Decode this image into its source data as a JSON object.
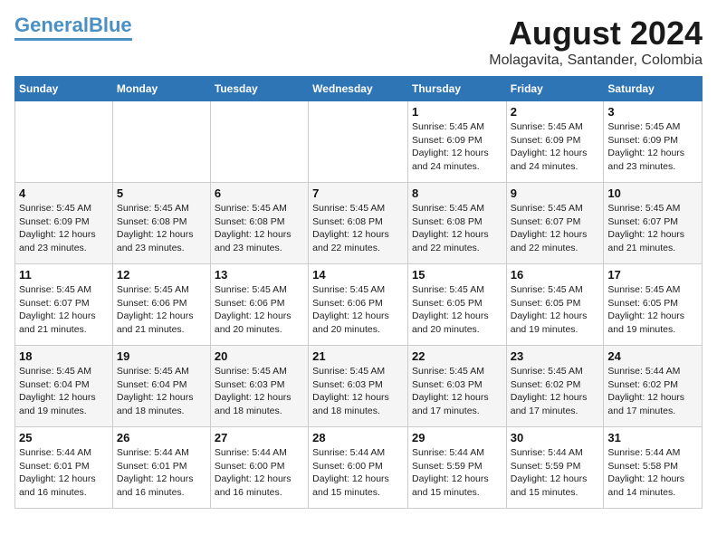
{
  "header": {
    "logo_line1": "General",
    "logo_line2": "Blue",
    "title": "August 2024",
    "subtitle": "Molagavita, Santander, Colombia"
  },
  "days_of_week": [
    "Sunday",
    "Monday",
    "Tuesday",
    "Wednesday",
    "Thursday",
    "Friday",
    "Saturday"
  ],
  "weeks": [
    [
      {
        "day": "",
        "info": ""
      },
      {
        "day": "",
        "info": ""
      },
      {
        "day": "",
        "info": ""
      },
      {
        "day": "",
        "info": ""
      },
      {
        "day": "1",
        "info": "Sunrise: 5:45 AM\nSunset: 6:09 PM\nDaylight: 12 hours and 24 minutes."
      },
      {
        "day": "2",
        "info": "Sunrise: 5:45 AM\nSunset: 6:09 PM\nDaylight: 12 hours and 24 minutes."
      },
      {
        "day": "3",
        "info": "Sunrise: 5:45 AM\nSunset: 6:09 PM\nDaylight: 12 hours and 23 minutes."
      }
    ],
    [
      {
        "day": "4",
        "info": "Sunrise: 5:45 AM\nSunset: 6:09 PM\nDaylight: 12 hours and 23 minutes."
      },
      {
        "day": "5",
        "info": "Sunrise: 5:45 AM\nSunset: 6:08 PM\nDaylight: 12 hours and 23 minutes."
      },
      {
        "day": "6",
        "info": "Sunrise: 5:45 AM\nSunset: 6:08 PM\nDaylight: 12 hours and 23 minutes."
      },
      {
        "day": "7",
        "info": "Sunrise: 5:45 AM\nSunset: 6:08 PM\nDaylight: 12 hours and 22 minutes."
      },
      {
        "day": "8",
        "info": "Sunrise: 5:45 AM\nSunset: 6:08 PM\nDaylight: 12 hours and 22 minutes."
      },
      {
        "day": "9",
        "info": "Sunrise: 5:45 AM\nSunset: 6:07 PM\nDaylight: 12 hours and 22 minutes."
      },
      {
        "day": "10",
        "info": "Sunrise: 5:45 AM\nSunset: 6:07 PM\nDaylight: 12 hours and 21 minutes."
      }
    ],
    [
      {
        "day": "11",
        "info": "Sunrise: 5:45 AM\nSunset: 6:07 PM\nDaylight: 12 hours and 21 minutes."
      },
      {
        "day": "12",
        "info": "Sunrise: 5:45 AM\nSunset: 6:06 PM\nDaylight: 12 hours and 21 minutes."
      },
      {
        "day": "13",
        "info": "Sunrise: 5:45 AM\nSunset: 6:06 PM\nDaylight: 12 hours and 20 minutes."
      },
      {
        "day": "14",
        "info": "Sunrise: 5:45 AM\nSunset: 6:06 PM\nDaylight: 12 hours and 20 minutes."
      },
      {
        "day": "15",
        "info": "Sunrise: 5:45 AM\nSunset: 6:05 PM\nDaylight: 12 hours and 20 minutes."
      },
      {
        "day": "16",
        "info": "Sunrise: 5:45 AM\nSunset: 6:05 PM\nDaylight: 12 hours and 19 minutes."
      },
      {
        "day": "17",
        "info": "Sunrise: 5:45 AM\nSunset: 6:05 PM\nDaylight: 12 hours and 19 minutes."
      }
    ],
    [
      {
        "day": "18",
        "info": "Sunrise: 5:45 AM\nSunset: 6:04 PM\nDaylight: 12 hours and 19 minutes."
      },
      {
        "day": "19",
        "info": "Sunrise: 5:45 AM\nSunset: 6:04 PM\nDaylight: 12 hours and 18 minutes."
      },
      {
        "day": "20",
        "info": "Sunrise: 5:45 AM\nSunset: 6:03 PM\nDaylight: 12 hours and 18 minutes."
      },
      {
        "day": "21",
        "info": "Sunrise: 5:45 AM\nSunset: 6:03 PM\nDaylight: 12 hours and 18 minutes."
      },
      {
        "day": "22",
        "info": "Sunrise: 5:45 AM\nSunset: 6:03 PM\nDaylight: 12 hours and 17 minutes."
      },
      {
        "day": "23",
        "info": "Sunrise: 5:45 AM\nSunset: 6:02 PM\nDaylight: 12 hours and 17 minutes."
      },
      {
        "day": "24",
        "info": "Sunrise: 5:44 AM\nSunset: 6:02 PM\nDaylight: 12 hours and 17 minutes."
      }
    ],
    [
      {
        "day": "25",
        "info": "Sunrise: 5:44 AM\nSunset: 6:01 PM\nDaylight: 12 hours and 16 minutes."
      },
      {
        "day": "26",
        "info": "Sunrise: 5:44 AM\nSunset: 6:01 PM\nDaylight: 12 hours and 16 minutes."
      },
      {
        "day": "27",
        "info": "Sunrise: 5:44 AM\nSunset: 6:00 PM\nDaylight: 12 hours and 16 minutes."
      },
      {
        "day": "28",
        "info": "Sunrise: 5:44 AM\nSunset: 6:00 PM\nDaylight: 12 hours and 15 minutes."
      },
      {
        "day": "29",
        "info": "Sunrise: 5:44 AM\nSunset: 5:59 PM\nDaylight: 12 hours and 15 minutes."
      },
      {
        "day": "30",
        "info": "Sunrise: 5:44 AM\nSunset: 5:59 PM\nDaylight: 12 hours and 15 minutes."
      },
      {
        "day": "31",
        "info": "Sunrise: 5:44 AM\nSunset: 5:58 PM\nDaylight: 12 hours and 14 minutes."
      }
    ]
  ]
}
